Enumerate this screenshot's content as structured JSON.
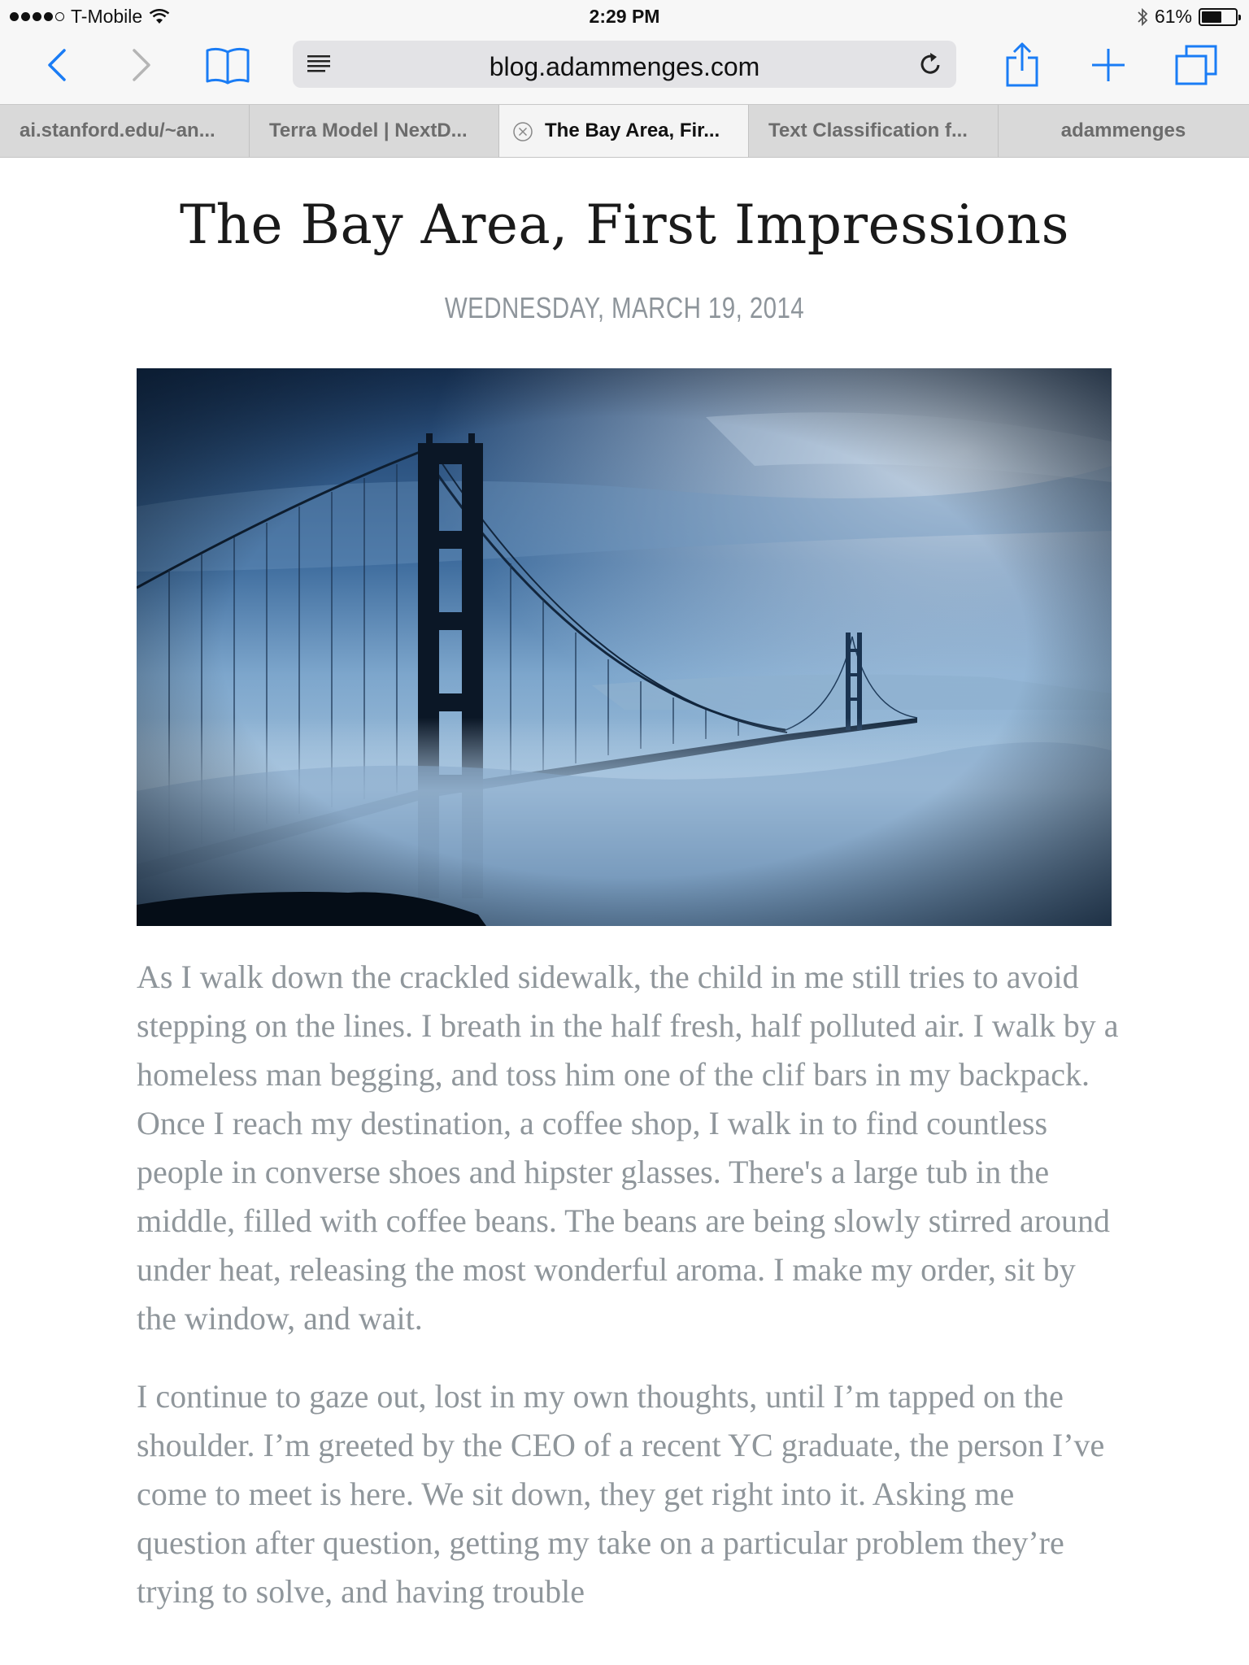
{
  "status": {
    "carrier": "T-Mobile",
    "time": "2:29 PM",
    "battery": "61%",
    "battery_level": 0.61
  },
  "toolbar": {
    "url": "blog.adammenges.com",
    "icons": [
      "back-icon",
      "forward-icon",
      "bookmarks-icon",
      "reader-icon",
      "reload-icon",
      "share-icon",
      "new-tab-icon",
      "tabs-icon"
    ]
  },
  "tabs": [
    {
      "label": "ai.stanford.edu/~an...",
      "active": false
    },
    {
      "label": "Terra Model | NextD...",
      "active": false
    },
    {
      "label": "The Bay Area, Fir...",
      "active": true
    },
    {
      "label": "Text Classification f...",
      "active": false
    },
    {
      "label": "adammenges",
      "active": false
    }
  ],
  "article": {
    "title": "The Bay Area, First Impressions",
    "date": "WEDNESDAY, MARCH 19, 2014",
    "paragraphs": [
      "As I walk down the crackled sidewalk, the child in me still tries to avoid stepping on the lines. I breath in the half fresh, half polluted air. I walk by a homeless man begging, and toss him one of the clif bars in my backpack. Once I reach my destination, a coffee shop, I walk in to find countless people in converse shoes and hipster glasses. There's a large tub in the middle, filled with coffee beans. The beans are being slowly stirred around under heat, releasing the most wonderful aroma. I make my order, sit by the window, and wait.",
      "I continue to gaze out, lost in my own thoughts, until I’m tapped on the shoulder. I’m greeted by the CEO of a recent YC graduate, the person I’ve come to meet is here. We sit down, they get right into it. Asking me question after question, getting my take on a particular problem they’re trying to solve, and having trouble"
    ]
  },
  "colors": {
    "accent": "#1a7cf5",
    "body_text": "#8f969b",
    "title_text": "#1a1a1a"
  }
}
